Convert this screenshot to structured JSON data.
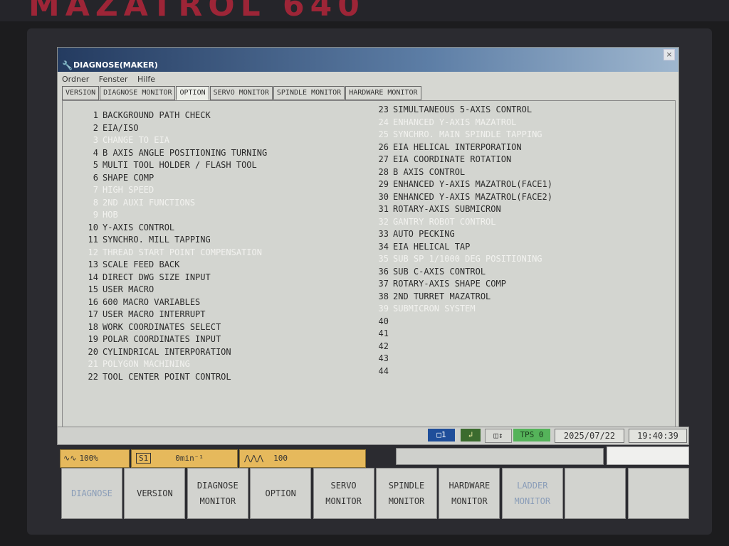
{
  "brand": "MAZATROL 640",
  "window": {
    "title": "DIAGNOSE(MAKER)",
    "close": "×"
  },
  "menu": [
    "Ordner",
    "Fenster",
    "Hilfe"
  ],
  "tabs": [
    "VERSION",
    "DIAGNOSE MONITOR",
    "OPTION",
    "SERVO MONITOR",
    "SPINDLE MONITOR",
    "HARDWARE MONITOR"
  ],
  "active_tab": "OPTION",
  "options_left": [
    {
      "num": "1",
      "label": "BACKGROUND PATH CHECK",
      "enabled": true
    },
    {
      "num": "2",
      "label": "EIA/ISO",
      "enabled": true
    },
    {
      "num": "3",
      "label": "CHANGE TO EIA",
      "enabled": false
    },
    {
      "num": "4",
      "label": "B AXIS ANGLE POSITIONING TURNING",
      "enabled": true
    },
    {
      "num": "5",
      "label": "MULTI TOOL HOLDER / FLASH TOOL",
      "enabled": true
    },
    {
      "num": "6",
      "label": "SHAPE COMP",
      "enabled": true
    },
    {
      "num": "7",
      "label": "HIGH SPEED",
      "enabled": false
    },
    {
      "num": "8",
      "label": "2ND AUXI FUNCTIONS",
      "enabled": false
    },
    {
      "num": "9",
      "label": "HOB",
      "enabled": false
    },
    {
      "num": "10",
      "label": "Y-AXIS CONTROL",
      "enabled": true
    },
    {
      "num": "11",
      "label": "SYNCHRO. MILL TAPPING",
      "enabled": true
    },
    {
      "num": "12",
      "label": "THREAD START POINT COMPENSATION",
      "enabled": false
    },
    {
      "num": "13",
      "label": "SCALE FEED BACK",
      "enabled": true
    },
    {
      "num": "14",
      "label": "DIRECT DWG SIZE INPUT",
      "enabled": true
    },
    {
      "num": "15",
      "label": "USER MACRO",
      "enabled": true
    },
    {
      "num": "16",
      "label": "600 MACRO VARIABLES",
      "enabled": true
    },
    {
      "num": "17",
      "label": "USER MACRO INTERRUPT",
      "enabled": true
    },
    {
      "num": "18",
      "label": "WORK COORDINATES SELECT",
      "enabled": true
    },
    {
      "num": "19",
      "label": "POLAR COORDINATES INPUT",
      "enabled": true
    },
    {
      "num": "20",
      "label": "CYLINDRICAL INTERPORATION",
      "enabled": true
    },
    {
      "num": "21",
      "label": "POLYGON MACHINING",
      "enabled": false
    },
    {
      "num": "22",
      "label": "TOOL CENTER POINT CONTROL",
      "enabled": true
    }
  ],
  "options_right": [
    {
      "num": "23",
      "label": "SIMULTANEOUS 5-AXIS CONTROL",
      "enabled": true
    },
    {
      "num": "24",
      "label": "ENHANCED Y-AXIS MAZATROL",
      "enabled": false
    },
    {
      "num": "25",
      "label": "SYNCHRO. MAIN SPINDLE TAPPING",
      "enabled": false
    },
    {
      "num": "26",
      "label": "EIA HELICAL INTERPORATION",
      "enabled": true
    },
    {
      "num": "27",
      "label": "EIA COORDINATE ROTATION",
      "enabled": true
    },
    {
      "num": "28",
      "label": "B AXIS CONTROL",
      "enabled": true
    },
    {
      "num": "29",
      "label": "ENHANCED Y-AXIS MAZATROL(FACE1)",
      "enabled": true
    },
    {
      "num": "30",
      "label": "ENHANCED Y-AXIS MAZATROL(FACE2)",
      "enabled": true
    },
    {
      "num": "31",
      "label": "ROTARY-AXIS SUBMICRON",
      "enabled": true
    },
    {
      "num": "32",
      "label": "GANTRY ROBOT CONTROL",
      "enabled": false
    },
    {
      "num": "33",
      "label": "AUTO PECKING",
      "enabled": true
    },
    {
      "num": "34",
      "label": "EIA HELICAL TAP",
      "enabled": true
    },
    {
      "num": "35",
      "label": "SUB SP 1/1000 DEG POSITIONING",
      "enabled": false
    },
    {
      "num": "36",
      "label": "SUB C-AXIS CONTROL",
      "enabled": true
    },
    {
      "num": "37",
      "label": "ROTARY-AXIS SHAPE COMP",
      "enabled": true
    },
    {
      "num": "38",
      "label": "2ND TURRET MAZATROL",
      "enabled": true
    },
    {
      "num": "39",
      "label": "SUBMICRON SYSTEM",
      "enabled": false
    },
    {
      "num": "40",
      "label": "",
      "enabled": true
    },
    {
      "num": "41",
      "label": "",
      "enabled": true
    },
    {
      "num": "42",
      "label": "",
      "enabled": true
    },
    {
      "num": "43",
      "label": "",
      "enabled": true
    },
    {
      "num": "44",
      "label": "",
      "enabled": true
    }
  ],
  "status": {
    "station": "1",
    "tps": "TPS 0",
    "date": "2025/07/22",
    "time": "19:40:39"
  },
  "indicators": {
    "feed_override": "100%",
    "spindle": "S1",
    "spindle_speed": "0min⁻¹",
    "rapid": "100"
  },
  "function_keys": [
    {
      "line1": "DIAGNOSE",
      "line2": "",
      "enabled": false
    },
    {
      "line1": "VERSION",
      "line2": "",
      "enabled": true
    },
    {
      "line1": "DIAGNOSE",
      "line2": "MONITOR",
      "enabled": true
    },
    {
      "line1": "OPTION",
      "line2": "",
      "enabled": true
    },
    {
      "line1": "SERVO",
      "line2": "MONITOR",
      "enabled": true
    },
    {
      "line1": "SPINDLE",
      "line2": "MONITOR",
      "enabled": true
    },
    {
      "line1": "HARDWARE",
      "line2": "MONITOR",
      "enabled": true
    },
    {
      "line1": "LADDER",
      "line2": "MONITOR",
      "enabled": false
    },
    {
      "line1": "",
      "line2": "",
      "enabled": true
    },
    {
      "line1": "",
      "line2": "",
      "enabled": true
    }
  ],
  "colors": {
    "title_bar": "#243b60",
    "indicator": "#e6b95c",
    "tps": "#4caf50",
    "station": "#1f4e9a",
    "disabled_text": "#f2f2ef"
  }
}
